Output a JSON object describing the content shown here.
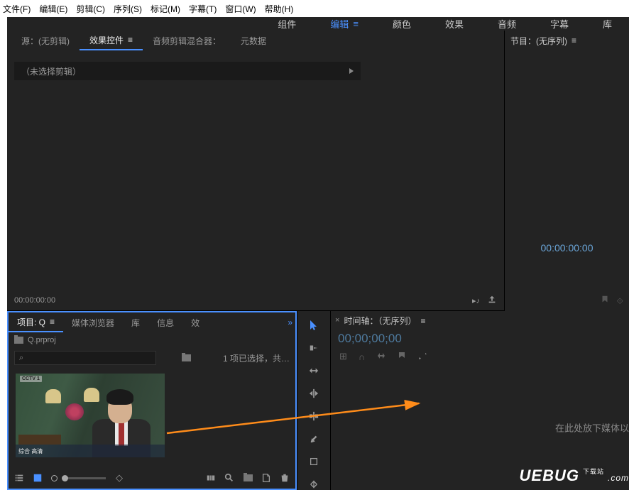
{
  "menubar": [
    "文件(F)",
    "编辑(E)",
    "剪辑(C)",
    "序列(S)",
    "标记(M)",
    "字幕(T)",
    "窗口(W)",
    "帮助(H)"
  ],
  "workspaces": {
    "items": [
      "组件",
      "编辑",
      "颜色",
      "效果",
      "音频",
      "字幕",
      "库"
    ],
    "active": "编辑"
  },
  "source": {
    "tabs": [
      "源：(无剪辑)",
      "效果控件",
      "音频剪辑混合器：",
      "元数据"
    ],
    "active": "效果控件",
    "unselected_text": "（未选择剪辑）",
    "timecode": "00:00:00:00"
  },
  "program": {
    "tab": "节目：(无序列)",
    "timecode": "00:00:00:00"
  },
  "project": {
    "tabs": [
      "项目: Q",
      "媒体浏览器",
      "库",
      "信息",
      "效"
    ],
    "active": "项目: Q",
    "file": "Q.prproj",
    "search_icon": "⌕",
    "selection_text": "1 项已选择，共…",
    "thumb_cctv": "CCTV 1",
    "thumb_overlay": "综合 高清"
  },
  "timeline": {
    "tab": "时间轴：（无序列）",
    "timecode": "00;00;00;00",
    "drop_hint": "在此处放下媒体以"
  },
  "watermark": {
    "text": "UEBUG",
    "badge": "下载站",
    "suffix": ".com"
  }
}
